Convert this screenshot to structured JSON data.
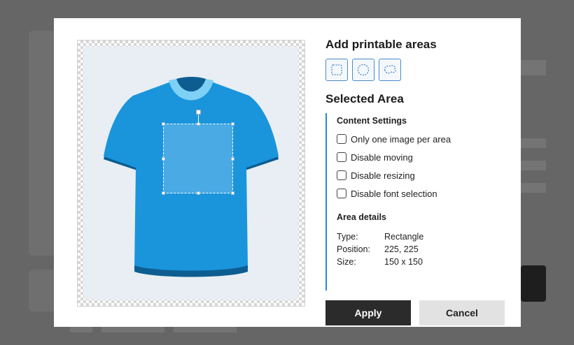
{
  "dialog": {
    "printable_title": "Add printable areas",
    "shape_tools": [
      {
        "icon": "rectangle-select-icon"
      },
      {
        "icon": "ellipse-select-icon"
      },
      {
        "icon": "freeform-select-icon"
      }
    ],
    "selected_title": "Selected Area",
    "content_settings": {
      "title": "Content Settings",
      "options": [
        {
          "label": "Only one image per area",
          "checked": false
        },
        {
          "label": "Disable moving",
          "checked": false
        },
        {
          "label": "Disable resizing",
          "checked": false
        },
        {
          "label": "Disable font selection",
          "checked": false
        }
      ]
    },
    "area_details": {
      "title": "Area details",
      "type_label": "Type:",
      "type_value": "Rectangle",
      "position_label": "Position:",
      "position_value": "225, 225",
      "size_label": "Size:",
      "size_value": "150 x 150"
    },
    "apply_label": "Apply",
    "cancel_label": "Cancel"
  },
  "colors": {
    "shirt": "#1a95dc",
    "shirt_dark": "#0d5d91",
    "collar": "#7fd0f5",
    "area": "#4aaae3",
    "accent": "#2e86d4"
  }
}
